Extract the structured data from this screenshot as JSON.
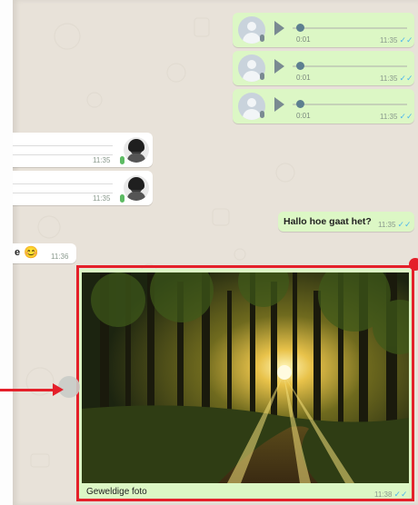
{
  "voice_messages": [
    {
      "duration": "0:01",
      "time": "11:35"
    },
    {
      "duration": "0:01",
      "time": "11:35"
    },
    {
      "duration": "0:01",
      "time": "11:35"
    }
  ],
  "incoming_voice": [
    {
      "time": "11:35"
    },
    {
      "time": "11:35"
    }
  ],
  "outgoing_text": {
    "text": "Hallo hoe gaat het?",
    "time": "11:35"
  },
  "incoming_text": {
    "text": "e",
    "emoji": "😊",
    "time": "11:36"
  },
  "photo_message": {
    "caption": "Geweldige foto",
    "time": "11:38"
  },
  "colors": {
    "outgoing_bubble": "#dcf7c5",
    "incoming_bubble": "#ffffff",
    "chat_background": "#e8e2d9",
    "highlight": "#e4202a",
    "read_ticks": "#4fb6ec"
  },
  "icons": {
    "read_receipt": "double-check-icon",
    "play": "play-icon",
    "microphone": "microphone-icon"
  }
}
